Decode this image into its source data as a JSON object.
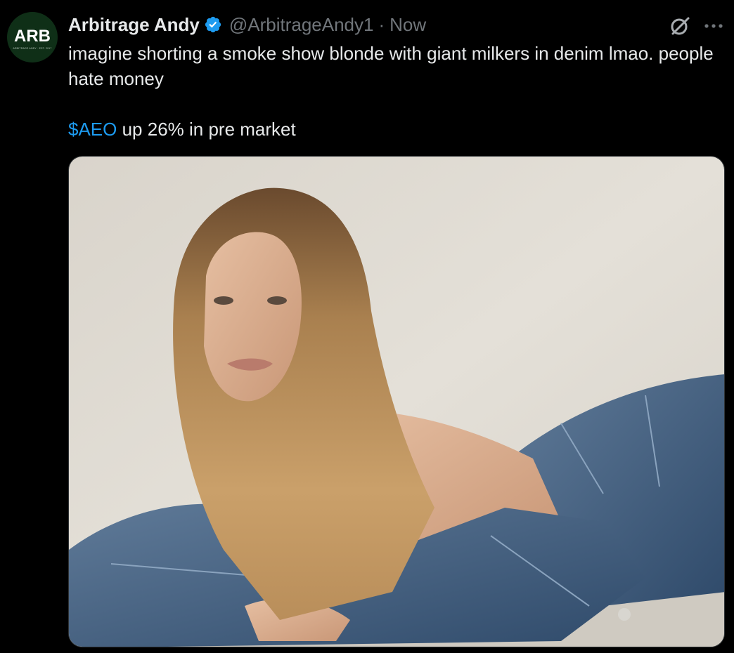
{
  "author": {
    "avatar_text": "ARB",
    "avatar_subtext": "ARBITRAGE ANDY · EST. 2017",
    "display_name": "Arbitrage Andy",
    "handle": "@ArbitrageAndy1",
    "separator": "·",
    "timestamp": "Now",
    "verified": true
  },
  "tweet": {
    "text_line": "imagine shorting a smoke show blonde with giant milkers in denim lmao. people hate money",
    "cashtag": "$AEO",
    "cashtag_rest": " up 26% in pre market"
  },
  "media": {
    "type": "photo"
  },
  "icons": {
    "verified": "verified-badge-icon",
    "grok": "grok-icon",
    "more": "more-options-icon"
  },
  "colors": {
    "background": "#000000",
    "text": "#e7e9ea",
    "secondary_text": "#71767b",
    "link": "#1d9bf0",
    "verified": "#1d9bf0"
  }
}
